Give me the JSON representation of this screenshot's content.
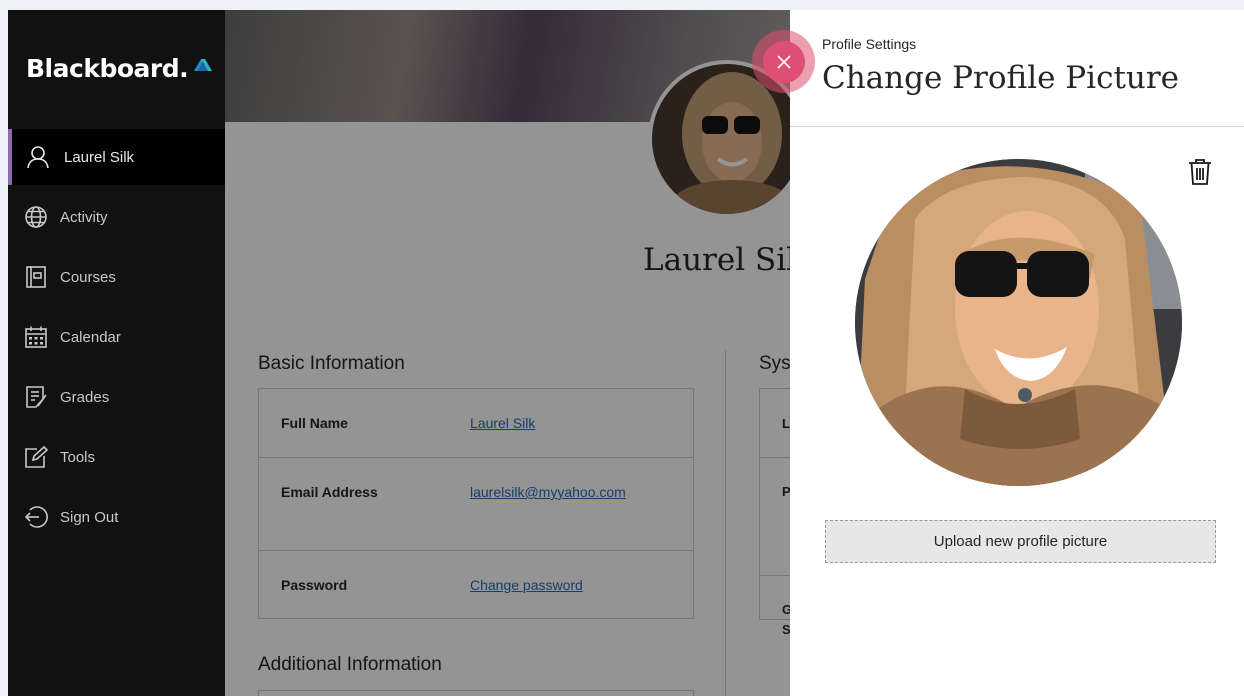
{
  "brand": {
    "name": "Blackboard",
    "dot": "."
  },
  "sidebar": {
    "items": [
      {
        "label": "Laurel Silk",
        "icon": "user-icon",
        "active": true
      },
      {
        "label": "Activity",
        "icon": "globe-icon"
      },
      {
        "label": "Courses",
        "icon": "courses-icon"
      },
      {
        "label": "Calendar",
        "icon": "calendar-icon"
      },
      {
        "label": "Grades",
        "icon": "grades-icon"
      },
      {
        "label": "Tools",
        "icon": "tools-icon"
      },
      {
        "label": "Sign Out",
        "icon": "sign-out-icon"
      }
    ]
  },
  "profile": {
    "name": "Laurel Sil",
    "basic_info_title": "Basic Information",
    "system_title": "Sys",
    "additional_title": "Additional Information",
    "rows": [
      {
        "label": "Full Name",
        "value": "Laurel Silk"
      },
      {
        "label": "Email Address",
        "value": "laurelsilk@myyahoo.com"
      },
      {
        "label": "Password",
        "value": "Change password"
      }
    ],
    "system_letters": [
      "L",
      "P",
      "G",
      "S"
    ]
  },
  "panel": {
    "kicker": "Profile Settings",
    "title": "Change Profile Picture",
    "upload_label": "Upload new profile picture",
    "close_icon": "close-icon",
    "delete_icon": "trash-icon"
  },
  "colors": {
    "sidebar_bg": "#111111",
    "active_accent": "#8c6bb1",
    "link": "#2a6bb7",
    "close_button": "#df4f73"
  }
}
